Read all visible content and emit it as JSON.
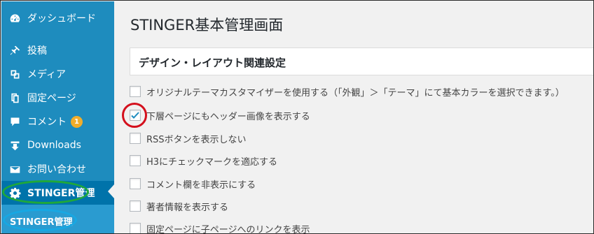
{
  "sidebar": {
    "items": [
      {
        "label": "ダッシュボード",
        "icon": "dashboard-icon"
      },
      {
        "label": "投稿",
        "icon": "pin-icon"
      },
      {
        "label": "メディア",
        "icon": "media-icon"
      },
      {
        "label": "固定ページ",
        "icon": "page-icon"
      },
      {
        "label": "コメント",
        "icon": "comment-icon",
        "badge": "1"
      },
      {
        "label": "Downloads",
        "icon": "download-icon"
      },
      {
        "label": "お問い合わせ",
        "icon": "mail-icon"
      },
      {
        "label": "STINGER管理",
        "icon": "gear-icon"
      }
    ],
    "submenu": {
      "label": "STINGER管理"
    }
  },
  "main": {
    "title": "STINGER基本管理画面",
    "section_title": "デザイン・レイアウト関連設定",
    "options": [
      {
        "label": "オリジナルテーマカスタマイザーを使用する（「外観」＞「テーマ」にて基本カラーを選択できます。）",
        "checked": false
      },
      {
        "label": "下層ページにもヘッダー画像を表示する",
        "checked": true
      },
      {
        "label": "RSSボタンを表示しない",
        "checked": false
      },
      {
        "label": "H3にチェックマークを適応する",
        "checked": false
      },
      {
        "label": "コメント欄を非表示にする",
        "checked": false
      },
      {
        "label": "著者情報を表示する",
        "checked": false
      },
      {
        "label": "固定ページに子ページへのリンクを表示",
        "checked": false
      }
    ]
  },
  "colors": {
    "sidebar_bg": "#1e8cbe",
    "badge": "#f0ad2b",
    "annotation_green": "#1fa83a",
    "annotation_blue": "#17a8e3",
    "annotation_red": "#d4101d"
  }
}
